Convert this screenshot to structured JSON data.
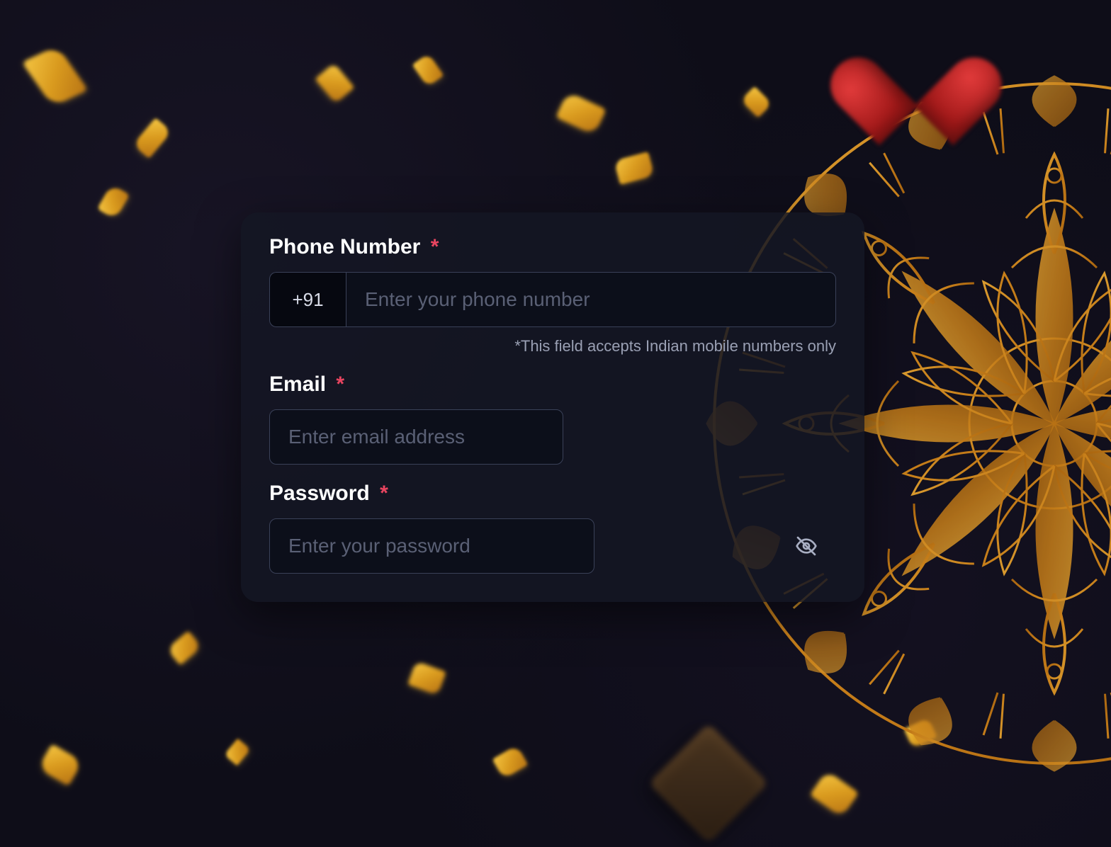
{
  "form": {
    "phone": {
      "label": "Phone Number",
      "required": "*",
      "prefix": "+91",
      "placeholder": "Enter your phone number",
      "helper": "*This field accepts Indian mobile numbers only"
    },
    "email": {
      "label": "Email",
      "required": "*",
      "placeholder": "Enter email address"
    },
    "password": {
      "label": "Password",
      "required": "*",
      "placeholder": "Enter your password"
    }
  }
}
